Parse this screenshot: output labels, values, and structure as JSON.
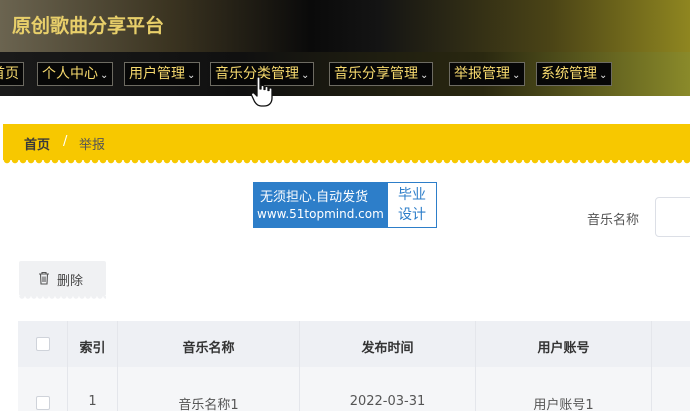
{
  "header": {
    "title": "原创歌曲分享平台"
  },
  "nav": {
    "items": [
      {
        "label": "首页",
        "has_dropdown": false
      },
      {
        "label": "个人中心",
        "has_dropdown": true
      },
      {
        "label": "用户管理",
        "has_dropdown": true
      },
      {
        "label": "音乐分类管理",
        "has_dropdown": true
      },
      {
        "label": "音乐分享管理",
        "has_dropdown": true
      },
      {
        "label": "举报管理",
        "has_dropdown": true
      },
      {
        "label": "系统管理",
        "has_dropdown": true
      }
    ],
    "chevron": "⌄"
  },
  "breadcrumb": {
    "home": "首页",
    "separator": "/",
    "current": "举报"
  },
  "ad": {
    "line1": "无须担心.自动发货",
    "line2": "www.51topmind.com",
    "side_line1": "毕业",
    "side_line2": "设计"
  },
  "search": {
    "label": "音乐名称",
    "value": ""
  },
  "toolbar": {
    "delete_label": "删除"
  },
  "table": {
    "headers": [
      "索引",
      "音乐名称",
      "发布时间",
      "用户账号"
    ],
    "rows": [
      {
        "index": "1",
        "music_name": "音乐名称1",
        "publish_time": "2022-03-31",
        "user_account": "用户账号1"
      }
    ]
  },
  "colors": {
    "accent": "#f7c800",
    "nav_text": "#f6d96e",
    "ad_blue": "#2d7ec9"
  }
}
